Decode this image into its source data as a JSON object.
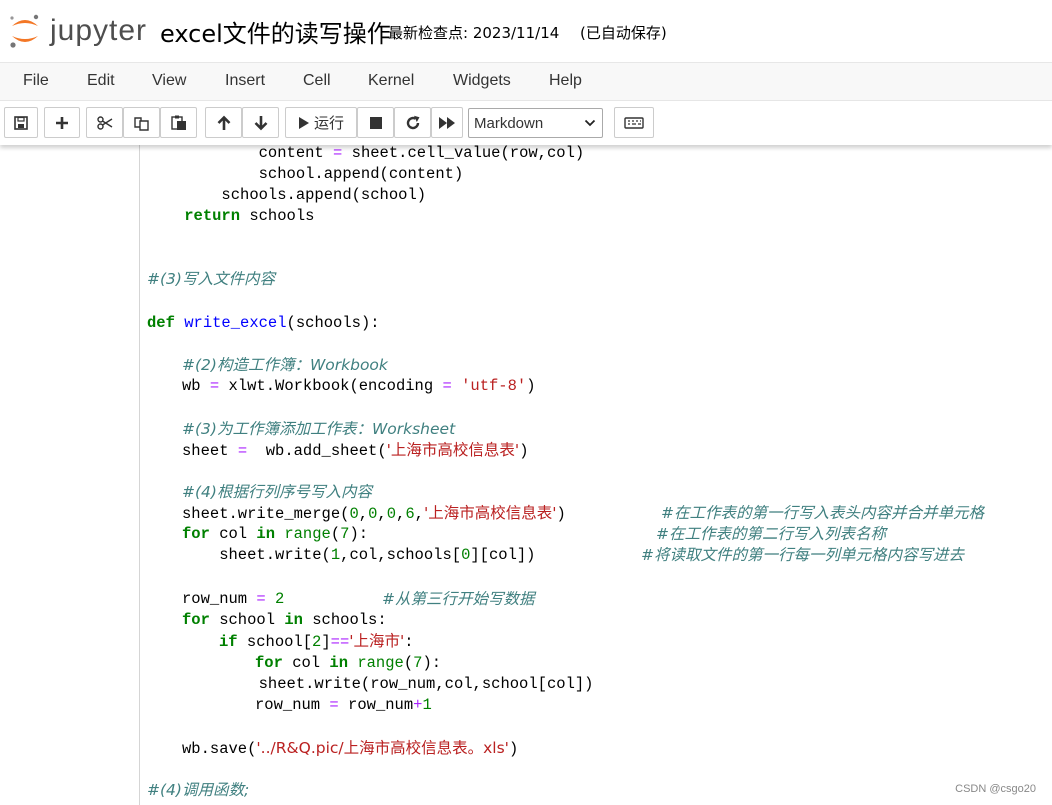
{
  "header": {
    "logo_text": "jupyter",
    "notebook_title": "excel文件的读写操作",
    "checkpoint": "最新检查点: 2023/11/14",
    "autosave": "(已自动保存)"
  },
  "menu": [
    "File",
    "Edit",
    "View",
    "Insert",
    "Cell",
    "Kernel",
    "Widgets",
    "Help"
  ],
  "toolbar": {
    "run_label": "运行",
    "cell_type": "Markdown",
    "icons": [
      "save-icon",
      "plus-icon",
      "cut-icon",
      "copy-icon",
      "paste-icon",
      "arrow-up-icon",
      "arrow-down-icon",
      "play-icon",
      "stop-icon",
      "restart-icon",
      "fast-forward-icon",
      "keyboard-icon"
    ]
  },
  "code": {
    "l1": {
      "a": "            content ",
      "b": "=",
      "c": " sheet.cell_value(row,col)"
    },
    "l2": {
      "a": "            school.append(content)"
    },
    "l3": {
      "a": "        schools.append(school)"
    },
    "l4": {
      "kw": "return",
      "a": " schools"
    },
    "l5": {
      "cm": "#(3)写入文件内容"
    },
    "l6": {
      "kw": "def",
      "fn": "write_excel",
      "a": "(schools):"
    },
    "l7": {
      "cm": "#(2)构造工作簿：Workbook"
    },
    "l8": {
      "a": "wb ",
      "b": "=",
      "c": " xlwt.Workbook(encoding ",
      "d": "=",
      "e": " ",
      "s": "'utf-8'",
      "f": ")"
    },
    "l9": {
      "cm": "#(3)为工作簿添加工作表：Worksheet"
    },
    "l10": {
      "a": "sheet ",
      "b": "=",
      "c": "  wb.add_sheet(",
      "s": "'上海市高校信息表'",
      "f": ")"
    },
    "l11": {
      "cm": "#(4)根据行列序号写入内容"
    },
    "l12": {
      "a": "sheet.write_merge(",
      "n1": "0",
      "c1": ",",
      "n2": "0",
      "c2": ",",
      "n3": "0",
      "c3": ",",
      "n4": "6",
      "c4": ",",
      "s": "'上海市高校信息表'",
      "f": ")",
      "cm": "#在工作表的第一行写入表头内容并合并单元格"
    },
    "l13": {
      "kw": "for",
      "a": " col ",
      "kw2": "in",
      "bi": " range",
      "b": "(",
      "n": "7",
      "c": "):",
      "cm": "#在工作表的第二行写入列表名称"
    },
    "l14": {
      "a": "    sheet.write(",
      "n": "1",
      "c": ",col,schools[",
      "n2": "0",
      "d": "][col])",
      "cm": "#将读取文件的第一行每一列单元格内容写进去"
    },
    "l15": {
      "a": "row_num ",
      "b": "=",
      "n": " 2",
      "cm": "#从第三行开始写数据"
    },
    "l16": {
      "kw": "for",
      "a": " school ",
      "kw2": "in",
      "c": " schools:"
    },
    "l17": {
      "kw": "if",
      "a": " school[",
      "n": "2",
      "b": "]",
      "op": "==",
      "s": "'上海市'",
      "c": ":"
    },
    "l18": {
      "kw": "for",
      "a": " col ",
      "kw2": "in",
      "bi": " range",
      "b": "(",
      "n": "7",
      "c": "):"
    },
    "l19": {
      "a": "            sheet.write(row_num,col,school[col])"
    },
    "l20": {
      "a": "row_num ",
      "b": "=",
      "c": " row_num",
      "op": "+",
      "n": "1"
    },
    "l21": {
      "a": "wb.save(",
      "s": "'../R&Q.pic/上海市高校信息表。xls'",
      "f": ")"
    },
    "l22": {
      "cm": "#(4)调用函数;"
    }
  },
  "watermark": "CSDN @csgo20"
}
